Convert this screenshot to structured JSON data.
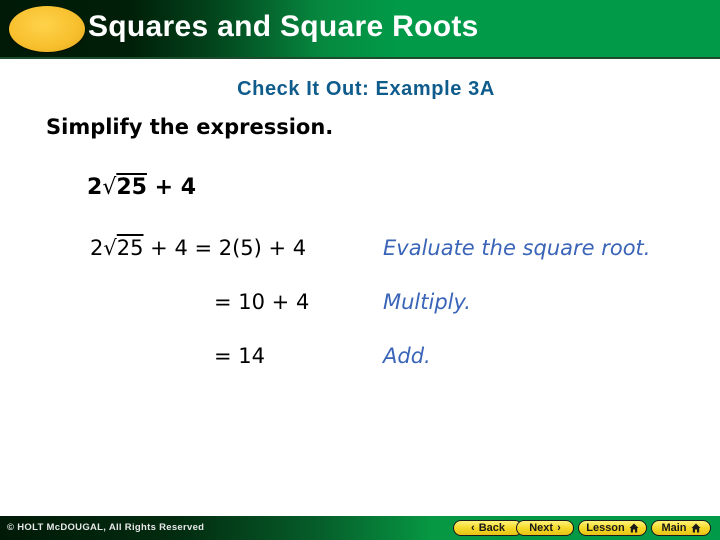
{
  "header": {
    "title": "Squares and Square Roots"
  },
  "content": {
    "subtitle": "Check It Out: Example 3A",
    "instruction": "Simplify the expression.",
    "expression": {
      "coefficient": "2",
      "radical_symbol": "√",
      "radicand": "25",
      "rest": " + 4"
    },
    "steps": [
      {
        "lhs_coefficient": "2",
        "lhs_radical": "√",
        "lhs_radicand": "25",
        "lhs_rest": " + 4 ",
        "rhs": "= 2(5) + 4",
        "note": "Evaluate the square root."
      },
      {
        "rhs": "= 10 + 4",
        "note": "Multiply."
      },
      {
        "rhs": "= 14",
        "note": "Add."
      }
    ]
  },
  "footer": {
    "copyright": "© HOLT McDOUGAL, All Rights Reserved",
    "nav": {
      "back_label": "Back",
      "back_icon": "‹",
      "next_label": "Next",
      "next_icon": "›",
      "lesson_label": "Lesson",
      "main_label": "Main"
    }
  },
  "colors": {
    "header_green": "#009a49",
    "oval_yellow": "#f7bf2d",
    "subtitle_blue": "#0f5c8c",
    "note_blue": "#3a64b8",
    "button_yellow": "#f5da2a"
  }
}
